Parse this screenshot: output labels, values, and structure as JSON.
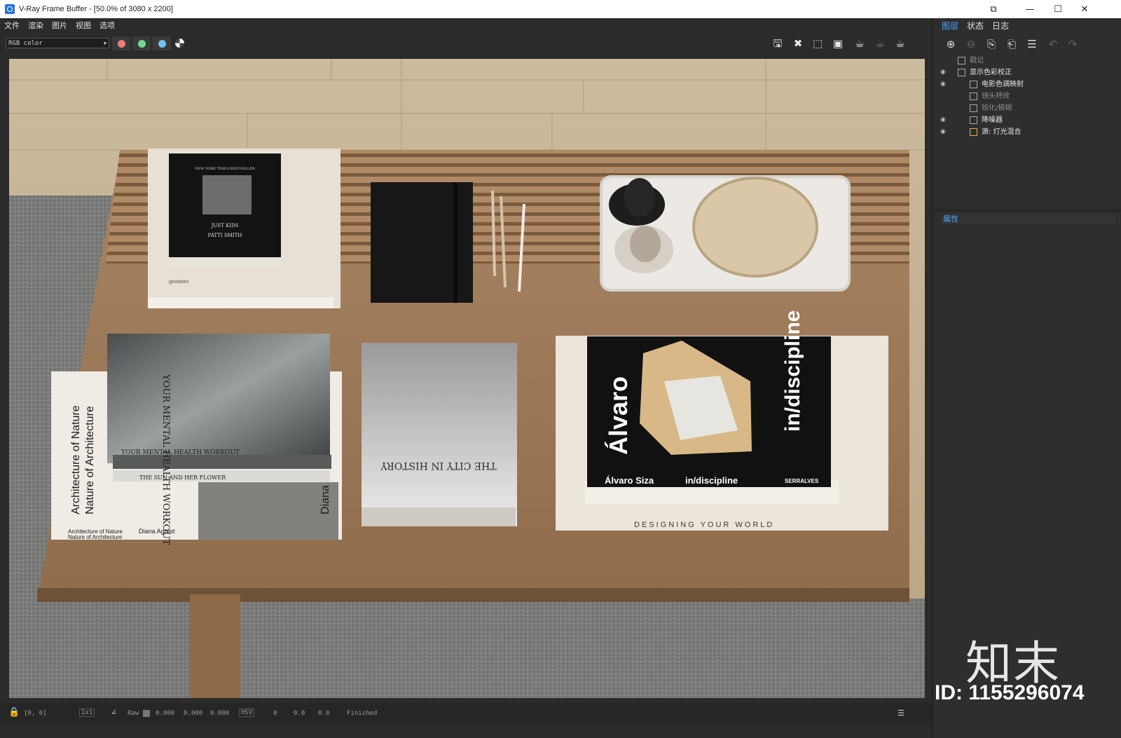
{
  "window": {
    "title": "V-Ray Frame Buffer - [50.0% of 3080 x 2200]",
    "controls": [
      "—",
      "☐",
      "✕"
    ]
  },
  "menu": [
    "文件",
    "渲染",
    "图片",
    "视图",
    "选项"
  ],
  "toolbar": {
    "channel": "RGB color",
    "channel_buttons": [
      {
        "name": "red-channel",
        "color": "#f07b7b"
      },
      {
        "name": "green-channel",
        "color": "#6fdc8b"
      },
      {
        "name": "blue-channel",
        "color": "#6fc3f0"
      }
    ]
  },
  "render": {
    "books": {
      "just_kids_top": "NEW YORK TIMES BESTSELLER",
      "just_kids_title": "JUST KIDS",
      "just_kids_author": "PATTI SMITH",
      "gestalten": "gestalten",
      "mental_health": "YOUR MENTAL HEALTH WORKOUT",
      "mental_health_spine": "YOUR MENTAL HEALTH WORKOUT",
      "sun_flower": "THE SUN AND HER FLOWER",
      "architecture": "Architecture of Nature",
      "architecture2": "Nature of Architecture",
      "agrest": "Diana Agrest",
      "diana": "Diana",
      "city_history": "THE CITY IN HISTORY",
      "alvaro": "Álvaro Siza",
      "alvaro_cover": "Álvaro",
      "indiscipline": "in/discipline",
      "indiscipline_cover": "in/discipline",
      "serralves": "SERRALVES",
      "designing": "DESIGNING YOUR WORLD"
    }
  },
  "status": {
    "coords": "[0, 0]",
    "ratio": "1x1",
    "mode": "Raw",
    "rgb": [
      "0.000",
      "0.000",
      "0.000"
    ],
    "color_space": "HSV",
    "hsv": [
      "0",
      "0.0",
      "0.0"
    ],
    "state": "Finished"
  },
  "panel": {
    "tabs": [
      "图层",
      "状态",
      "日志"
    ],
    "layers": [
      {
        "label": "戳记",
        "visible": false,
        "indent": 0,
        "dim": true
      },
      {
        "label": "显示色彩校正",
        "visible": true,
        "indent": 0,
        "dim": false
      },
      {
        "label": "电影色调映射",
        "visible": true,
        "indent": 1,
        "dim": false
      },
      {
        "label": "镜头特效",
        "visible": false,
        "indent": 1,
        "dim": true
      },
      {
        "label": "锐化/模糊",
        "visible": false,
        "indent": 1,
        "dim": true
      },
      {
        "label": "降噪器",
        "visible": true,
        "indent": 1,
        "dim": false
      },
      {
        "label": "源: 灯光混合",
        "visible": true,
        "indent": 1,
        "dim": false
      }
    ],
    "properties_label": "属性"
  },
  "watermark": {
    "mark": "知末",
    "id": "ID: 1155296074"
  }
}
